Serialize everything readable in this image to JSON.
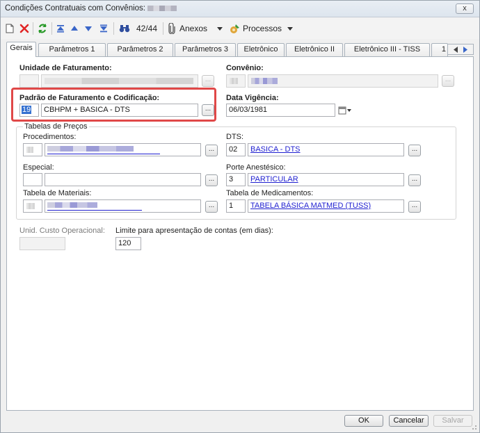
{
  "window": {
    "title": "Condições Contratuais com Convênios:",
    "close_label": "x"
  },
  "toolbar": {
    "record_position": "42/44",
    "anexos_label": "Anexos",
    "processos_label": "Processos",
    "icons": [
      "new-document-icon",
      "delete-icon",
      "refresh-icon",
      "first-record-icon",
      "previous-record-icon",
      "next-record-icon",
      "last-record-icon",
      "binoculars-icon",
      "paperclip-icon",
      "process-icon"
    ]
  },
  "tabs": [
    {
      "label": "Gerais"
    },
    {
      "label": "Parâmetros 1"
    },
    {
      "label": "Parâmetros 2"
    },
    {
      "label": "Parâmetros 3"
    },
    {
      "label": "Eletrônico"
    },
    {
      "label": "Eletrônico II"
    },
    {
      "label": "Eletrônico III - TISS"
    },
    {
      "label": "1"
    }
  ],
  "form": {
    "unidade_faturamento_label": "Unidade de Faturamento:",
    "convenio_label": "Convênio:",
    "padrao_label": "Padrão de Faturamento e Codificação:",
    "padrao_code": "19",
    "padrao_value": "CBHPM + BASICA - DTS",
    "data_vigencia_label": "Data Vigência:",
    "data_vigencia_value": "06/03/1981",
    "tabelas_group_label": "Tabelas de Preços",
    "procedimentos_label": "Procedimentos:",
    "dts_label": "DTS:",
    "dts_code": "02",
    "dts_value": "BASICA - DTS",
    "especial_label": "Especial:",
    "porte_label": "Porte Anestésico:",
    "porte_code": "3",
    "porte_value": "PARTICULAR",
    "materiais_label": "Tabela de Materiais:",
    "medicamentos_label": "Tabela de Medicamentos:",
    "medicamentos_code": "1",
    "medicamentos_value": "TABELA BÁSICA MATMED (TUSS)",
    "custo_label": "Unid. Custo Operacional:",
    "limite_label": "Limite para apresentação de contas (em dias):",
    "limite_value": "120",
    "dots_label": "..."
  },
  "footer": {
    "ok_label": "OK",
    "cancel_label": "Cancelar",
    "save_label": "Salvar"
  },
  "colors": {
    "highlight": "#e04848",
    "link": "#1f1fd0"
  }
}
